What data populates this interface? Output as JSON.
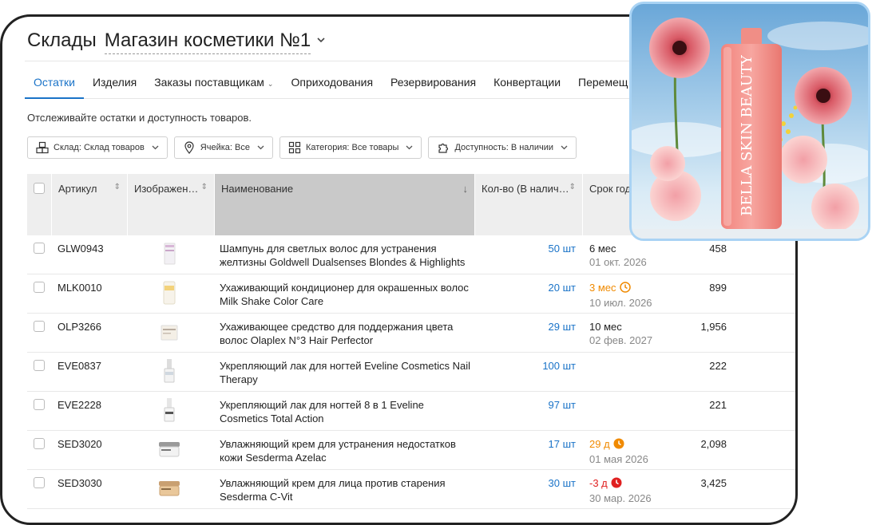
{
  "header": {
    "title": "Склады",
    "store": "Магазин косметики №1"
  },
  "tabs": [
    {
      "label": "Остатки",
      "active": true
    },
    {
      "label": "Изделия"
    },
    {
      "label": "Заказы поставщикам",
      "dropdown": true
    },
    {
      "label": "Оприходования"
    },
    {
      "label": "Резервирования"
    },
    {
      "label": "Конвертации"
    },
    {
      "label": "Перемещ"
    }
  ],
  "subtitle": "Отслеживайте остатки и доступность товаров.",
  "filters": [
    {
      "label": "Склад: Склад товаров",
      "icon": "boxes-icon"
    },
    {
      "label": "Ячейка: Все",
      "icon": "location-pin-icon"
    },
    {
      "label": "Категория: Все товары",
      "icon": "category-grid-icon"
    },
    {
      "label": "Доступность: В наличии",
      "icon": "puzzle-icon"
    }
  ],
  "table": {
    "columns": {
      "sku": "Артикул",
      "image": "Изображен…",
      "name": "Наименование",
      "qty": "Кол-во (В налич…",
      "shelf": "Срок год"
    },
    "rows": [
      {
        "sku": "GLW0943",
        "name": "Шампунь для светлых волос для устранения желтизны Goldwell Dualsenses Blondes & Highlights",
        "qty": "50 шт",
        "shelf": "6 мес",
        "shelf_status": "normal",
        "date": "01 окт. 2026",
        "price": "458"
      },
      {
        "sku": "MLK0010",
        "name": "Ухаживающий кондиционер для окрашенных волос Milk Shake Color Care",
        "qty": "20 шт",
        "shelf": "3 мес",
        "shelf_status": "warn",
        "date": "10 июл. 2026",
        "price": "899"
      },
      {
        "sku": "OLP3266",
        "name": "Ухаживающее средство для поддержания цвета волос Olaplex N°3 Hair Perfector",
        "qty": "29 шт",
        "shelf": "10 мес",
        "shelf_status": "normal",
        "date": "02 фев. 2027",
        "price": "1,956"
      },
      {
        "sku": "EVE0837",
        "name": "Укрепляющий лак для ногтей Eveline Cosmetics Nail Therapy",
        "qty": "100 шт",
        "shelf": "",
        "shelf_status": "none",
        "date": "",
        "price": "222"
      },
      {
        "sku": "EVE2228",
        "name": "Укрепляющий лак для ногтей 8 в 1 Eveline Cosmetics Total Action",
        "qty": "97 шт",
        "shelf": "",
        "shelf_status": "none",
        "date": "",
        "price": "221"
      },
      {
        "sku": "SED3020",
        "name": "Увлажняющий крем для устранения недостатков кожи Sesderma Azelac",
        "qty": "17 шт",
        "shelf": "29 д",
        "shelf_status": "warn-solid",
        "date": "01 мая 2026",
        "price": "2,098"
      },
      {
        "sku": "SED3030",
        "name": "Увлажняющий крем для лица против старения Sesderma C-Vit",
        "qty": "30 шт",
        "shelf": "-3 д",
        "shelf_status": "crit",
        "date": "30 мар. 2026",
        "price": "3,425"
      }
    ]
  },
  "photo": {
    "brand_text": "BELLA SKIN BEAUTY"
  },
  "colors": {
    "accent": "#1a73c8",
    "warn": "#f08a00",
    "crit": "#e02020"
  }
}
